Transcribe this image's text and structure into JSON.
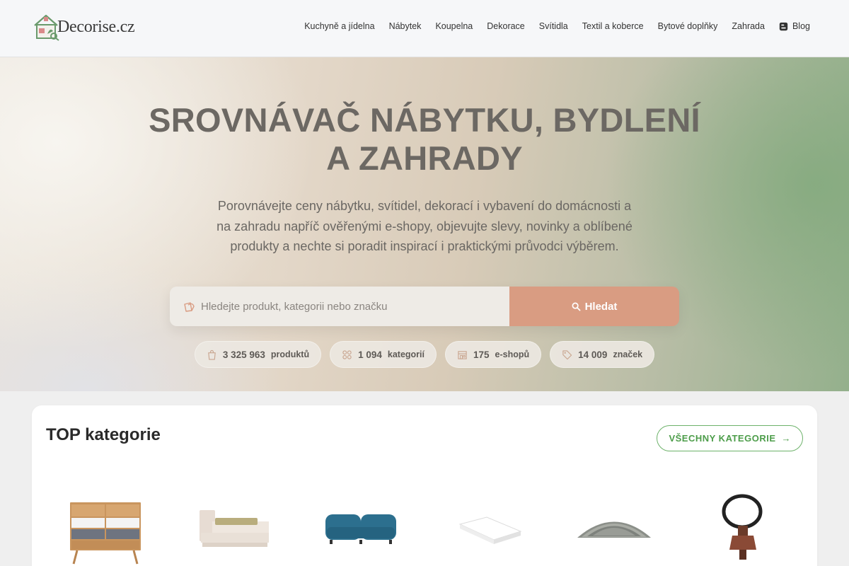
{
  "header": {
    "logo_text": "Decorise.cz",
    "nav": [
      {
        "label": "Kuchyně a jídelna"
      },
      {
        "label": "Nábytek"
      },
      {
        "label": "Koupelna"
      },
      {
        "label": "Dekorace"
      },
      {
        "label": "Svítidla"
      },
      {
        "label": "Textil a koberce"
      },
      {
        "label": "Bytové doplňky"
      },
      {
        "label": "Zahrada"
      }
    ],
    "blog_label": "Blog"
  },
  "hero": {
    "title_line1": "SROVNÁVAČ NÁBYTKU, BYDLENÍ",
    "title_line2": "A ZAHRADY",
    "subtitle": "Porovnávejte ceny nábytku, svítidel, dekorací i vybavení do domácnosti a na zahradu napříč ověřenými e-shopy, objevujte slevy, novinky a oblíbené produkty a nechte si poradit inspirací i praktickými průvodci výběrem.",
    "search": {
      "placeholder": "Hledejte produkt, kategorii nebo značku",
      "value": "",
      "button_label": "Hledat"
    },
    "stats": [
      {
        "value": "3 325 963",
        "label": "produktů",
        "icon": "shopping-bag-icon"
      },
      {
        "value": "1 094",
        "label": "kategorií",
        "icon": "grid-icon"
      },
      {
        "value": "175",
        "label": "e-shopů",
        "icon": "store-icon"
      },
      {
        "value": "14 009",
        "label": "značek",
        "icon": "tag-icon"
      }
    ]
  },
  "top_categories": {
    "title": "TOP kategorie",
    "all_button_label": "VŠECHNY KATEGORIE",
    "all_button_arrow": "→",
    "items": [
      {
        "image": "dresser-image"
      },
      {
        "image": "bed-image"
      },
      {
        "image": "sofa-image"
      },
      {
        "image": "mattress-image"
      },
      {
        "image": "rug-image"
      },
      {
        "image": "pendant-lamp-image"
      }
    ]
  },
  "colors": {
    "accent_green": "#4d9d4a",
    "search_button": "#d99c82"
  }
}
